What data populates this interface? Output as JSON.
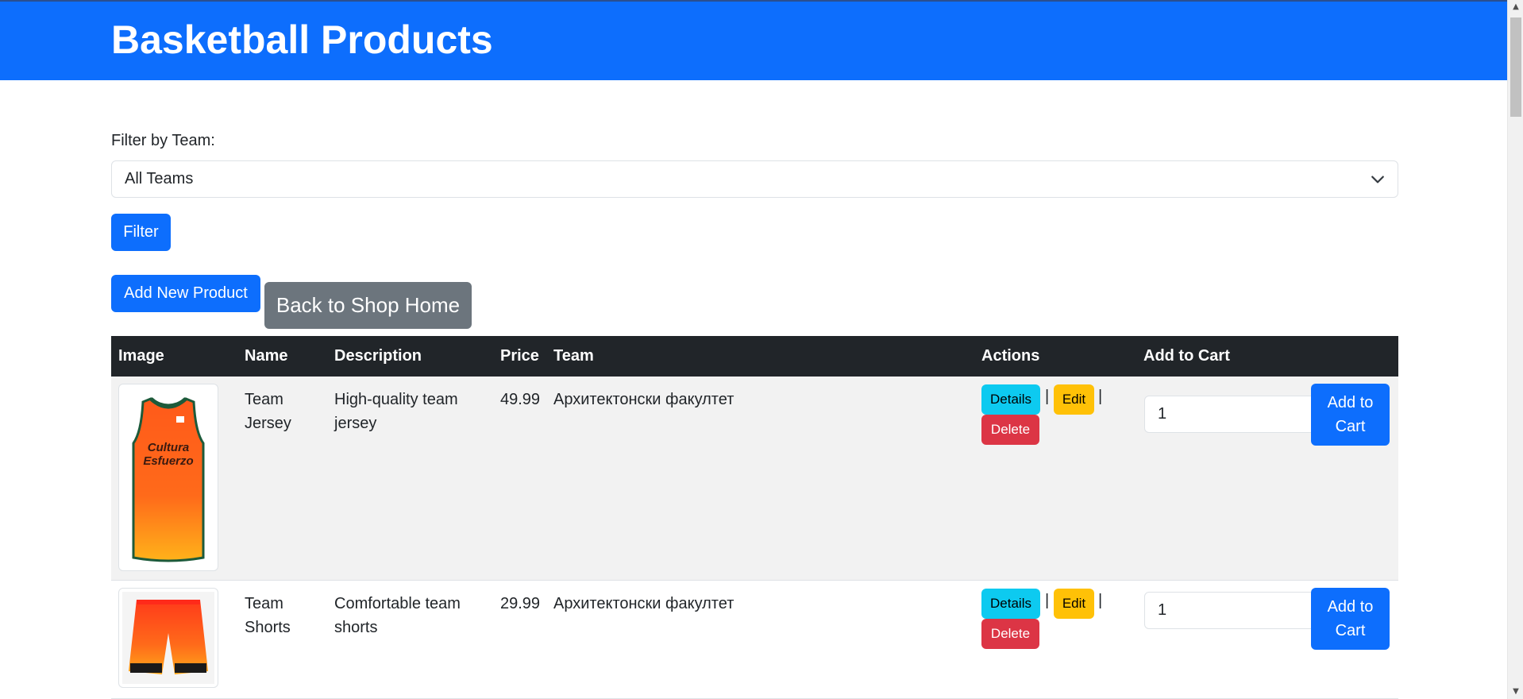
{
  "header": {
    "title": "Basketball Products"
  },
  "filter": {
    "label": "Filter by Team:",
    "selected": "All Teams",
    "button": "Filter"
  },
  "actions": {
    "add_new": "Add New Product",
    "back": "Back to Shop Home"
  },
  "table": {
    "columns": [
      "Image",
      "Name",
      "Description",
      "Price",
      "Team",
      "Actions",
      "Add to Cart"
    ],
    "rows": [
      {
        "name": "Team Jersey",
        "description": "High-quality team jersey",
        "price": "49.99",
        "team": "Архитектонски факултет",
        "image_icon": "jersey-image",
        "jersey_text": "Cultura Esfuerzo",
        "quantity": "1"
      },
      {
        "name": "Team Shorts",
        "description": "Comfortable team shorts",
        "price": "29.99",
        "team": "Архитектонски факултет",
        "image_icon": "shorts-image",
        "quantity": "1"
      }
    ],
    "row_buttons": {
      "details": "Details",
      "edit": "Edit",
      "delete": "Delete",
      "separator": "|",
      "add_to_cart": "Add to Cart"
    }
  },
  "colors": {
    "primary": "#0d6efd",
    "secondary": "#6c757d",
    "info": "#0dcaf0",
    "warning": "#ffc107",
    "danger": "#dc3545",
    "table_head": "#212529"
  }
}
